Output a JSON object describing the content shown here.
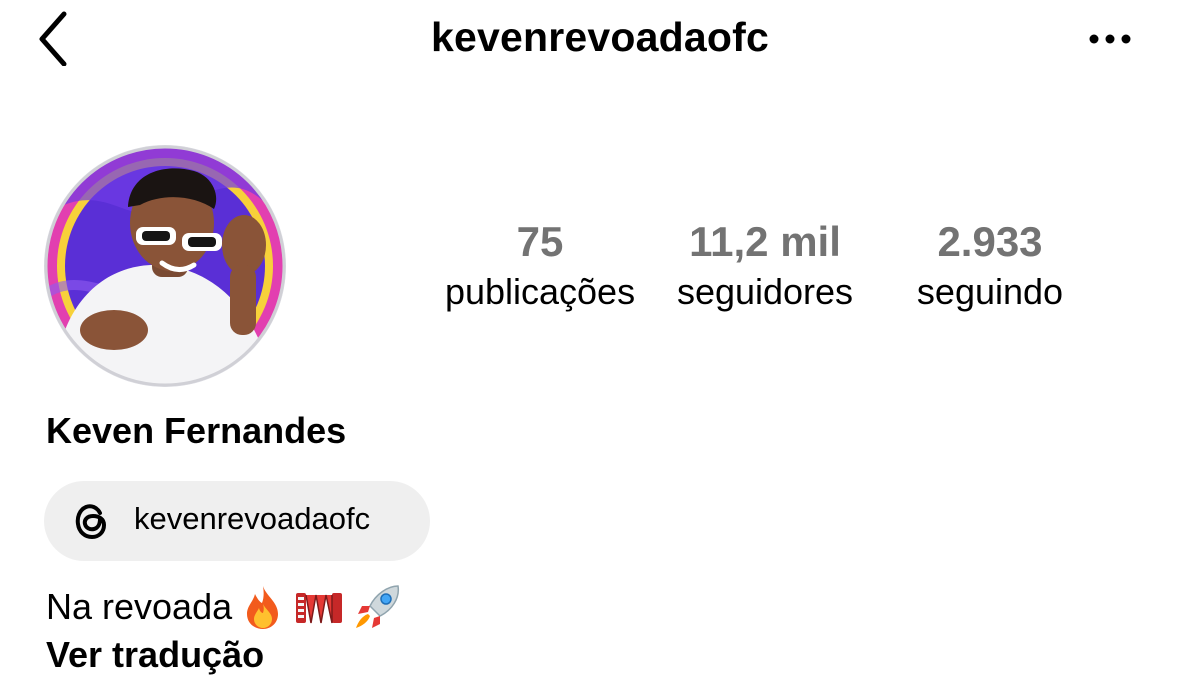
{
  "header": {
    "username": "kevenrevoadaofc",
    "back_icon": "chevron-left-icon",
    "more_icon": "ellipsis-icon"
  },
  "profile": {
    "avatar_icon": "profile-photo",
    "display_name": "Keven Fernandes",
    "stats": {
      "posts": {
        "value": "75",
        "label": "publicações"
      },
      "followers": {
        "value": "11,2 mil",
        "label": "seguidores"
      },
      "following": {
        "value": "2.933",
        "label": "seguindo"
      }
    },
    "threads": {
      "icon": "threads-icon",
      "handle": "kevenrevoadaofc"
    },
    "bio": {
      "text": "Na revoada",
      "emojis": [
        "fire-emoji",
        "accordion-emoji",
        "rocket-emoji"
      ]
    },
    "translate_label": "Ver tradução"
  },
  "colors": {
    "stat_value": "#737373",
    "chip_background": "#efefef",
    "text": "#000000"
  }
}
